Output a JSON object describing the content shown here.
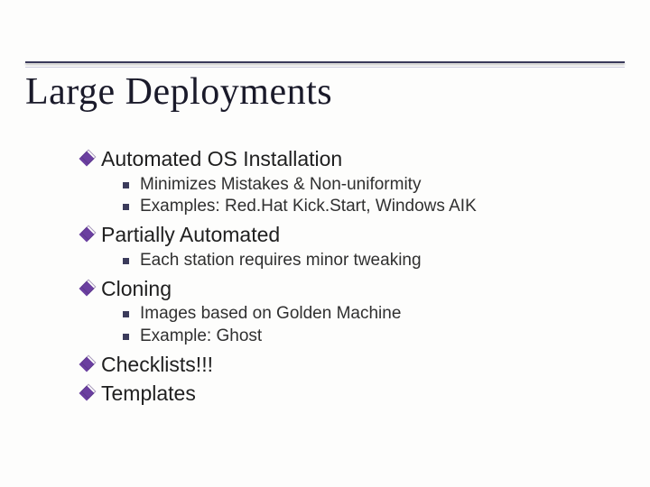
{
  "title": "Large Deployments",
  "items": [
    {
      "label": "Automated OS Installation",
      "sub": [
        "Minimizes Mistakes & Non-uniformity",
        "Examples: Red.Hat Kick.Start, Windows AIK"
      ]
    },
    {
      "label": "Partially Automated",
      "sub": [
        "Each station requires minor tweaking"
      ]
    },
    {
      "label": "Cloning",
      "sub": [
        "Images based on Golden Machine",
        "Example: Ghost"
      ]
    },
    {
      "label": "Checklists!!!",
      "sub": []
    },
    {
      "label": "Templates",
      "sub": []
    }
  ]
}
